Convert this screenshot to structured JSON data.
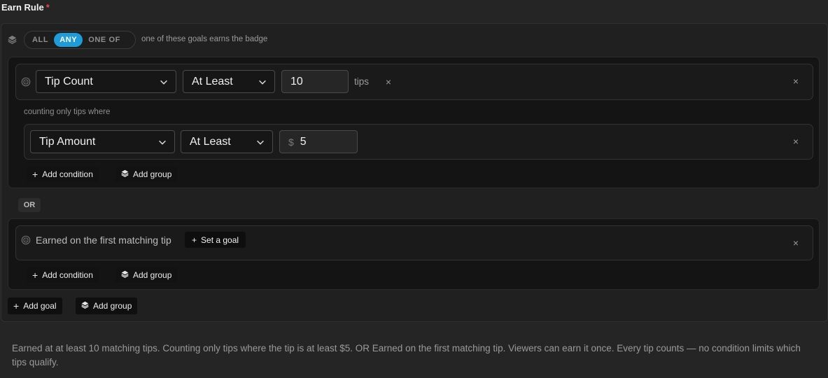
{
  "earn_rule": {
    "label": "Earn Rule",
    "required_mark": "*"
  },
  "mode": {
    "options": [
      "ALL",
      "ANY",
      "ONE OF"
    ],
    "selected": "ANY",
    "hint": "one of these goals earns the badge"
  },
  "goal1": {
    "metric": "Tip Count",
    "operator": "At Least",
    "value": "10",
    "unit": "tips",
    "filter_note": "counting only tips where",
    "condition": {
      "field": "Tip Amount",
      "operator": "At Least",
      "currency": "$",
      "value": "5"
    },
    "add_condition": "Add condition",
    "add_group": "Add group"
  },
  "or_label": "OR",
  "goal2": {
    "text": "Earned on the first matching tip",
    "set_goal": "Set a goal",
    "add_condition": "Add condition",
    "add_group": "Add group"
  },
  "footer_actions": {
    "add_goal": "Add goal",
    "add_group": "Add group"
  },
  "summary": "Earned at at least 10 matching tips. Counting only tips where the tip is at least $5. OR Earned on the first matching tip. Viewers can earn it once. Every tip counts — no condition limits which tips qualify.",
  "icons": {
    "mode": "layers-icon",
    "goal": "target-icon",
    "dropdown": "chevron-down-icon",
    "remove": "close-icon",
    "add": "plus-icon",
    "group": "layers-icon"
  },
  "colors": {
    "accent": "#1f9bd8",
    "required": "#e5484d",
    "background": "#252525"
  }
}
